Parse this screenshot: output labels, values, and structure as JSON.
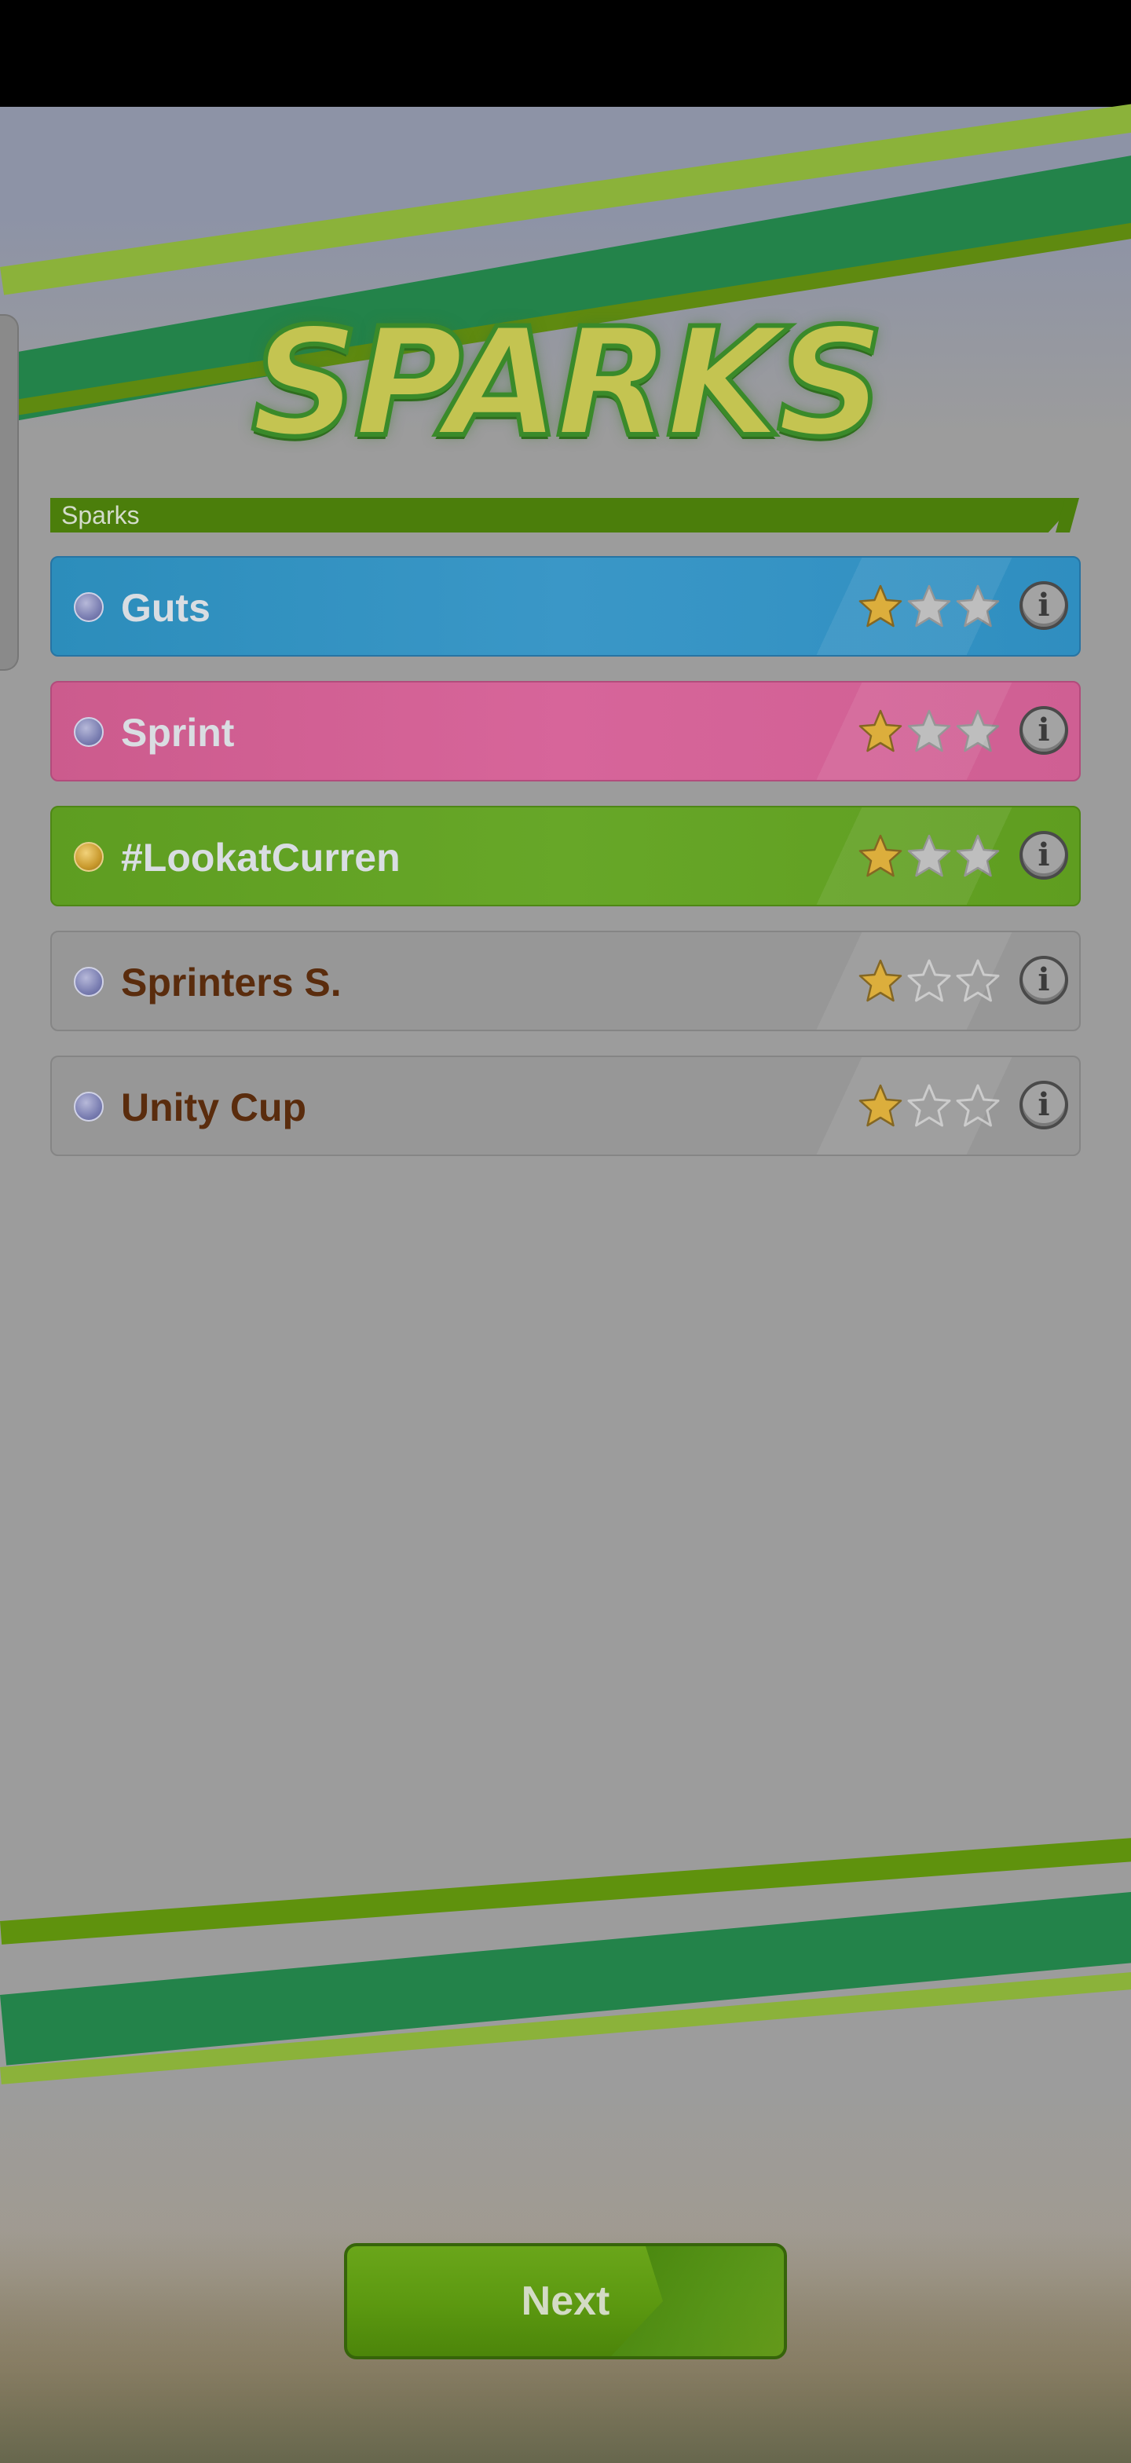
{
  "screen": {
    "title": "SPARKS",
    "colors": {
      "accent_green": "#4b7e0b",
      "row_blue": "#2c8dbb",
      "row_pink": "#cc5b8d",
      "row_green": "#5e9d21",
      "row_gray": "#979797",
      "star_gold": "#d9a72b"
    }
  },
  "section": {
    "label": "Sparks"
  },
  "sparks": [
    {
      "name": "Guts",
      "color": "blue",
      "gem": "blue-gem",
      "stars": 1,
      "max_stars": 3,
      "info_icon": "info-icon",
      "info_label": "i"
    },
    {
      "name": "Sprint",
      "color": "pink",
      "gem": "blue-gem",
      "stars": 1,
      "max_stars": 3,
      "info_icon": "info-icon",
      "info_label": "i"
    },
    {
      "name": "#LookatCurren",
      "color": "green",
      "gem": "gold-gem",
      "stars": 1,
      "max_stars": 3,
      "info_icon": "info-icon",
      "info_label": "i"
    },
    {
      "name": "Sprinters S.",
      "color": "gray",
      "gem": "blue-gem",
      "stars": 1,
      "max_stars": 3,
      "info_icon": "info-icon",
      "info_label": "i"
    },
    {
      "name": "Unity Cup",
      "color": "gray",
      "gem": "blue-gem",
      "stars": 1,
      "max_stars": 3,
      "info_icon": "info-icon",
      "info_label": "i"
    }
  ],
  "footer": {
    "next_label": "Next"
  }
}
